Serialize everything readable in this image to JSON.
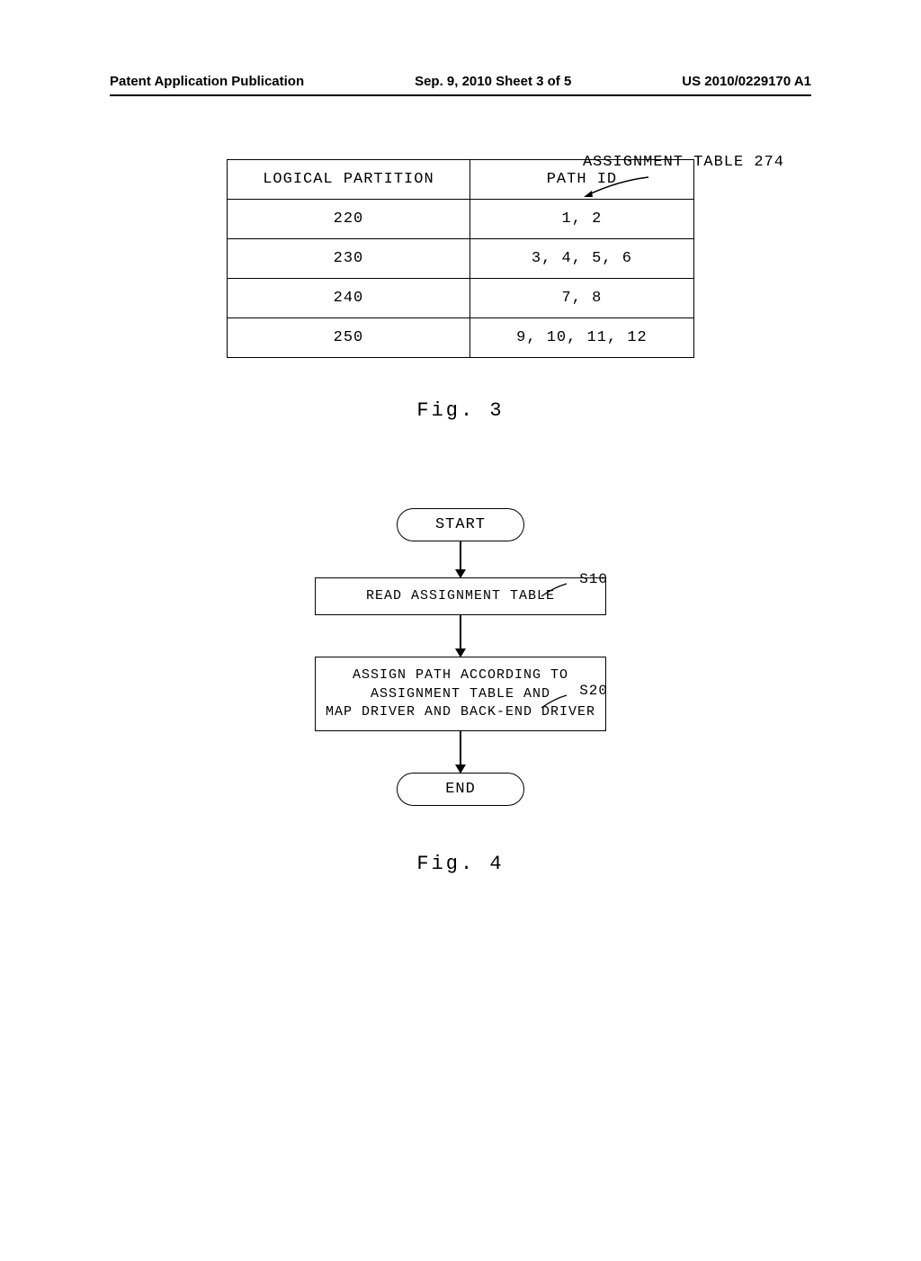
{
  "header": {
    "left": "Patent Application Publication",
    "mid": "Sep. 9, 2010  Sheet 3 of 5",
    "right": "US 2010/0229170 A1"
  },
  "fig3": {
    "label": "ASSIGNMENT TABLE 274",
    "caption": "Fig. 3",
    "columns": [
      "LOGICAL PARTITION",
      "PATH ID"
    ],
    "rows": [
      [
        "220",
        "1, 2"
      ],
      [
        "230",
        "3, 4, 5, 6"
      ],
      [
        "240",
        "7, 8"
      ],
      [
        "250",
        "9, 10, 11, 12"
      ]
    ]
  },
  "fig4": {
    "caption": "Fig. 4",
    "start": "START",
    "end": "END",
    "steps": {
      "s10": {
        "label": "S10",
        "text": "READ ASSIGNMENT TABLE"
      },
      "s20": {
        "label": "S20",
        "text": "ASSIGN PATH ACCORDING TO\nASSIGNMENT TABLE AND\nMAP DRIVER AND BACK-END DRIVER"
      }
    }
  },
  "chart_data": [
    {
      "type": "table",
      "title": "ASSIGNMENT TABLE 274",
      "columns": [
        "LOGICAL PARTITION",
        "PATH ID"
      ],
      "rows": [
        [
          "220",
          "1, 2"
        ],
        [
          "230",
          "3, 4, 5, 6"
        ],
        [
          "240",
          "7, 8"
        ],
        [
          "250",
          "9, 10, 11, 12"
        ]
      ]
    }
  ]
}
